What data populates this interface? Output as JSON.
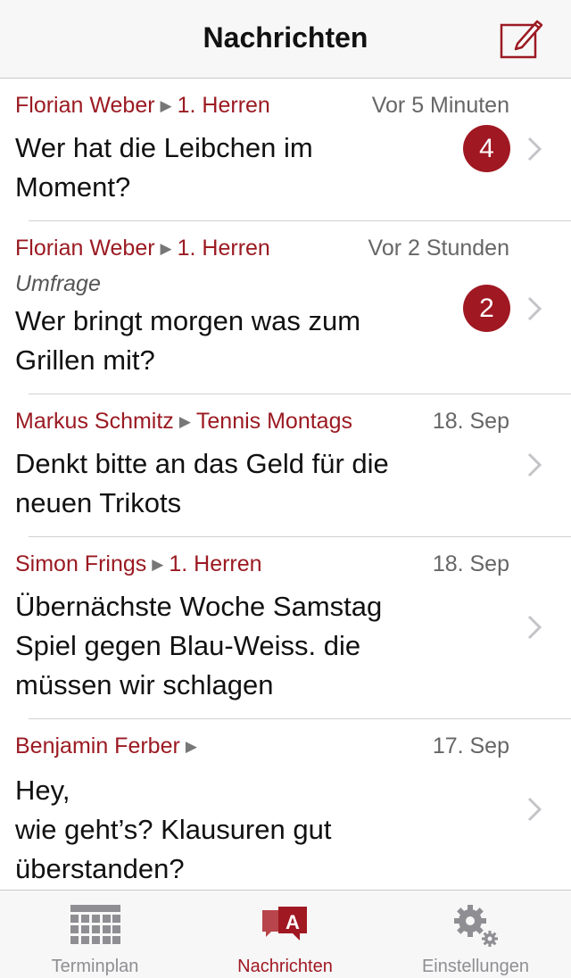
{
  "header": {
    "title": "Nachrichten",
    "compose_icon": "compose-icon"
  },
  "messages": [
    {
      "sender": "Florian Weber",
      "group": "1. Herren",
      "time": "Vor 5 Minuten",
      "label": "",
      "lines": [
        "Wer hat die Leibchen im",
        "Moment?"
      ],
      "badge": "4"
    },
    {
      "sender": "Florian Weber",
      "group": "1. Herren",
      "time": "Vor 2 Stunden",
      "label": "Umfrage",
      "lines": [
        "Wer bringt morgen was zum",
        "Grillen mit?"
      ],
      "badge": "2"
    },
    {
      "sender": "Markus Schmitz",
      "group": "Tennis Montags",
      "time": "18. Sep",
      "label": "",
      "lines": [
        "Denkt bitte an das Geld für die",
        "neuen Trikots"
      ],
      "badge": ""
    },
    {
      "sender": "Simon Frings",
      "group": "1. Herren",
      "time": "18. Sep",
      "label": "",
      "lines": [
        "Übernächste Woche Samstag",
        "Spiel gegen Blau-Weiss. die",
        "müssen wir schlagen"
      ],
      "badge": ""
    },
    {
      "sender": "Benjamin Ferber",
      "group": "",
      "time": "17. Sep",
      "label": "",
      "lines": [
        "Hey,",
        "wie geht’s? Klausuren gut",
        "überstanden?"
      ],
      "badge": ""
    }
  ],
  "tabs": [
    {
      "label": "Terminplan",
      "icon": "calendar-grid-icon",
      "active": false
    },
    {
      "label": "Nachrichten",
      "icon": "messages-icon",
      "active": true
    },
    {
      "label": "Einstellungen",
      "icon": "gear-icon",
      "active": false
    }
  ],
  "colors": {
    "accent": "#a01822",
    "inactive": "#8e8e93",
    "bar_bg": "#f7f7f7"
  }
}
